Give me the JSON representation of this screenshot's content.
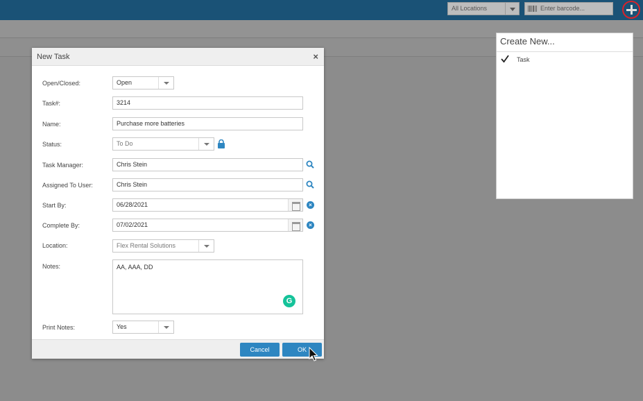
{
  "topbar": {
    "location_select": "All Locations",
    "barcode_placeholder": "Enter barcode..."
  },
  "create_panel": {
    "title": "Create New...",
    "items": [
      {
        "label": "Task",
        "checked": true
      }
    ]
  },
  "dialog": {
    "title": "New Task",
    "close_icon": "×",
    "fields": {
      "open_closed": {
        "label": "Open/Closed:",
        "value": "Open"
      },
      "task_number": {
        "label": "Task#:",
        "value": "3214"
      },
      "name": {
        "label": "Name:",
        "value": "Purchase more batteries"
      },
      "status": {
        "label": "Status:",
        "value": "To Do"
      },
      "task_manager": {
        "label": "Task Manager:",
        "value": "Chris Stein"
      },
      "assigned_to_user": {
        "label": "Assigned To User:",
        "value": "Chris Stein"
      },
      "start_by": {
        "label": "Start By:",
        "value": "06/28/2021"
      },
      "complete_by": {
        "label": "Complete By:",
        "value": "07/02/2021"
      },
      "location": {
        "label": "Location:",
        "value": "Flex Rental Solutions"
      },
      "notes": {
        "label": "Notes:",
        "value": "AA, AAA, DD"
      },
      "print_notes": {
        "label": "Print Notes:",
        "value": "Yes"
      }
    },
    "buttons": {
      "cancel": "Cancel",
      "ok": "OK"
    }
  },
  "icons": {
    "clear": "×",
    "grammarly": "G"
  },
  "colors": {
    "topbar": "#1a5276",
    "accent": "#2e86c1",
    "overlay": "#8c8c8c",
    "plus_ring": "#d8232a",
    "grammarly": "#15c39a"
  }
}
